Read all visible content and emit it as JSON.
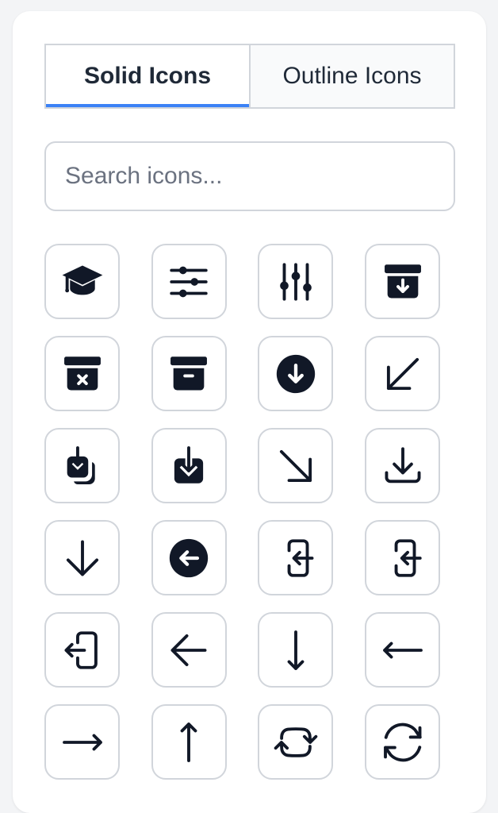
{
  "tabs": {
    "solid_label": "Solid Icons",
    "outline_label": "Outline Icons",
    "active": "solid"
  },
  "search": {
    "placeholder": "Search icons...",
    "value": ""
  },
  "colors": {
    "accent": "#3b82f6",
    "icon": "#111827",
    "border": "#d1d5db"
  },
  "icons": [
    "academic-cap-icon",
    "adjustments-horizontal-icon",
    "adjustments-vertical-icon",
    "archive-box-arrow-down-icon",
    "archive-box-x-mark-icon",
    "archive-box-icon",
    "arrow-down-circle-icon",
    "arrow-down-left-icon",
    "arrow-down-on-square-stack-icon",
    "arrow-down-on-square-icon",
    "arrow-down-right-icon",
    "arrow-down-tray-icon",
    "arrow-down-icon",
    "arrow-left-circle-icon",
    "arrow-left-end-on-rectangle-icon",
    "arrow-left-on-rectangle-icon",
    "arrow-left-start-on-rectangle-icon",
    "arrow-left-icon",
    "arrow-long-down-icon",
    "arrow-long-left-icon",
    "arrow-long-right-icon",
    "arrow-long-up-icon",
    "arrow-path-rounded-square-icon",
    "arrow-path-icon"
  ]
}
